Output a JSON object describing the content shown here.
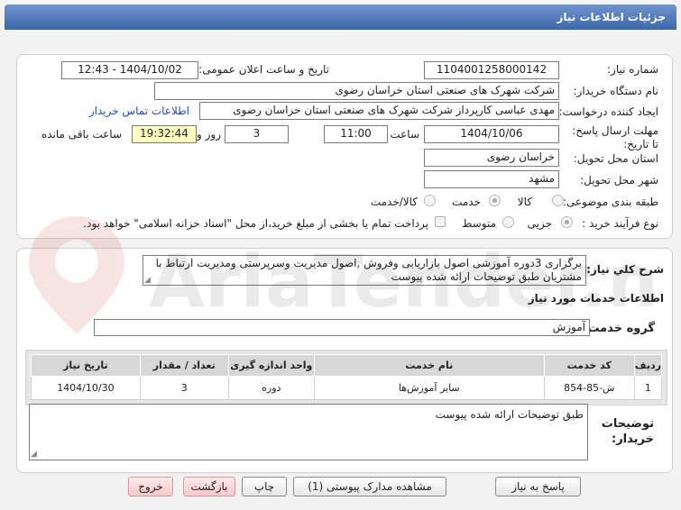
{
  "header": {
    "title": "جزئیات اطلاعات نیاز"
  },
  "watermark": {
    "text": "AriaTender.net"
  },
  "form": {
    "need_number_label": "شماره نیاز:",
    "need_number": "1104001258000142",
    "announce_label": "تاریخ و ساعت اعلان عمومی:",
    "announce_value": "1404/10/02 - 12:43",
    "buyer_org_label": "نام دستگاه خریدار:",
    "buyer_org": "شرکت شهرک های صنعتی استان خراسان رضوی",
    "creator_label": "ایجاد کننده درخواست:",
    "creator": "مهدی عباسی کارپرداز شرکت شهرک های صنعتی استان خراسان رضوی",
    "contact_link": "اطلاعات تماس خریدار",
    "deadline_label": "مهلت ارسال پاسخ: تا تاریخ:",
    "deadline_date": "1404/10/06",
    "hour_label": "ساعت",
    "deadline_time": "11:00",
    "days_value": "3",
    "days_label": "روز و",
    "remaining_time": "19:32:44",
    "remaining_label": "ساعت باقی مانده",
    "province_label": "استان محل تحویل:",
    "province": "خراسان رضوی",
    "city_label": "شهر محل تحویل:",
    "city": "مشهد",
    "category_label": "طبقه بندی موضوعی:",
    "category_options": [
      "کالا",
      "خدمت",
      "کالا/خدمت"
    ],
    "category_selected": 1,
    "process_label": "نوع فرآیند خرید :",
    "process_options": [
      "جزیی",
      "متوسط"
    ],
    "process_selected": 0,
    "payment_note": "پرداخت تمام یا بخشی از مبلغ خرید،از محل \"اسناد خزانه اسلامی\" خواهد بود."
  },
  "description": {
    "label": "شرح کلي نياز:",
    "text": "برگزاری 3دوره آموزشی اصول بازاریابی وفروش ,اصول مدیریت وسرپرستی ومدیریت ارتباط با مشتریان طبق توضیحات ارائه شده پیوست"
  },
  "services": {
    "section_title": "اطلاعات خدمات مورد نیاز",
    "group_label": "گروه خدمت:",
    "group_value": "آموزش",
    "columns": [
      "ردیف",
      "کد خدمت",
      "نام خدمت",
      "واحد اندازه گیری",
      "تعداد / مقدار",
      "تاریخ نیاز"
    ],
    "rows": [
      [
        "1",
        "ش-85-854",
        "سایر آموزش‌ها",
        "دوره",
        "3",
        "1404/10/30"
      ]
    ]
  },
  "buyer_notes": {
    "label": "توضیحات خریدار:",
    "text": "طبق توضیحات ارائه شده پیوست"
  },
  "buttons": {
    "reply": "پاسخ به نیاز",
    "attachments": "مشاهده مدارک پیوستی (1)",
    "print": "چاپ",
    "back": "بازگشت",
    "exit": "خروج"
  }
}
